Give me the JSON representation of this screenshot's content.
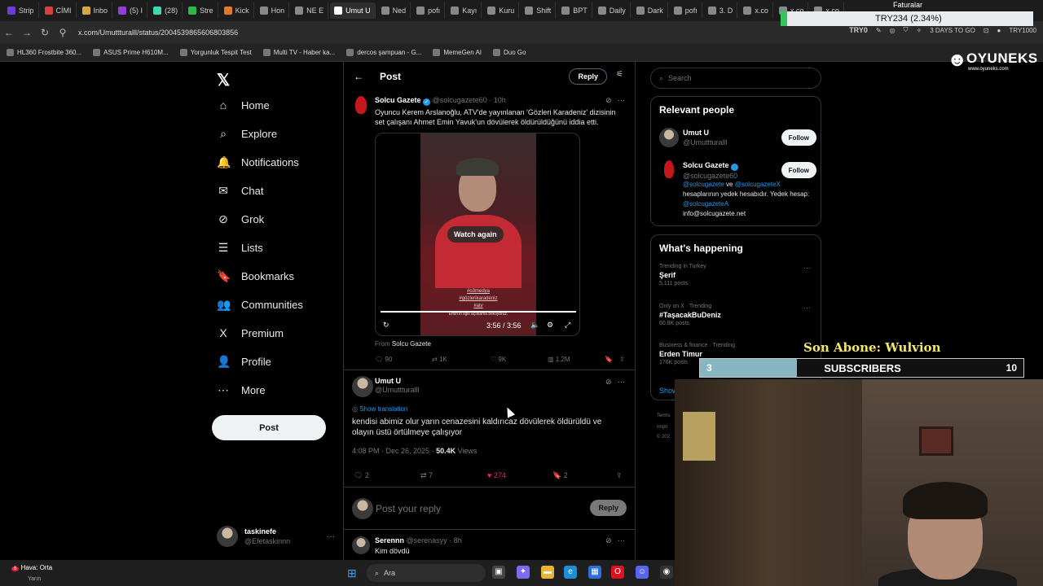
{
  "browser": {
    "tabs": [
      {
        "label": "Strip",
        "color": "#6b3fd6"
      },
      {
        "label": "CİMI",
        "color": "#d63f3f"
      },
      {
        "label": "Inbo",
        "color": "#d6a83f"
      },
      {
        "label": "(5) I",
        "color": "#8f3fd6"
      },
      {
        "label": "(28)",
        "color": "#3fd6b0"
      },
      {
        "label": "Stre",
        "color": "#2fb84a"
      },
      {
        "label": "Kick",
        "color": "#e0792b"
      },
      {
        "label": "Hon",
        "color": "#888888"
      },
      {
        "label": "NE E",
        "color": "#888888"
      },
      {
        "label": "Umut U",
        "color": "#ffffff"
      },
      {
        "label": "Ned",
        "color": "#888888"
      },
      {
        "label": "pofı",
        "color": "#888888"
      },
      {
        "label": "Kayı",
        "color": "#888888"
      },
      {
        "label": "Kuru",
        "color": "#888888"
      },
      {
        "label": "Shift",
        "color": "#888888"
      },
      {
        "label": "BPT",
        "color": "#888888"
      },
      {
        "label": "Daily",
        "color": "#888888"
      },
      {
        "label": "Dark",
        "color": "#888888"
      },
      {
        "label": "pofı",
        "color": "#888888"
      },
      {
        "label": "3. D",
        "color": "#888888"
      },
      {
        "label": "x.co",
        "color": "#888888"
      },
      {
        "label": "x.co",
        "color": "#888888"
      },
      {
        "label": "x.co",
        "color": "#888888"
      }
    ],
    "active_tab_index": 9,
    "url": "x.com/Umuttturalll/status/2004539865606803856",
    "addr_right": {
      "ext1": "TRY0",
      "days": "3 DAYS TO GO",
      "ext2": "TRY1000"
    },
    "bookmarks": [
      {
        "label": "HL360 Frostbite 360..."
      },
      {
        "label": "ASUS Prime H610M..."
      },
      {
        "label": "Yorgunluk Tespit Test"
      },
      {
        "label": "Multi TV - Haber ka..."
      },
      {
        "label": "dercos şampuan - G..."
      },
      {
        "label": "MemeGen AI"
      },
      {
        "label": "Duo Go"
      }
    ]
  },
  "nav": {
    "items": [
      {
        "label": "Home",
        "icon": "⌂"
      },
      {
        "label": "Explore",
        "icon": "⌕"
      },
      {
        "label": "Notifications",
        "icon": "🔔"
      },
      {
        "label": "Chat",
        "icon": "✉"
      },
      {
        "label": "Grok",
        "icon": "⊘"
      },
      {
        "label": "Lists",
        "icon": "☰"
      },
      {
        "label": "Bookmarks",
        "icon": "🔖"
      },
      {
        "label": "Communities",
        "icon": "👥"
      },
      {
        "label": "Premium",
        "icon": "X"
      },
      {
        "label": "Profile",
        "icon": "👤"
      },
      {
        "label": "More",
        "icon": "⋯"
      }
    ],
    "post_label": "Post",
    "account": {
      "name": "taskinefe",
      "handle": "@Efetaskinnn"
    }
  },
  "header": {
    "title": "Post",
    "reply_label": "Reply"
  },
  "quoted_post": {
    "author": "Solcu Gazete",
    "handle": "@solcugazete60",
    "time": "10h",
    "text": "Oyuncu Kerem Arslanoğlu, ATV'de yayınlanan 'Gözleri Karadeniz' dizisinin set çalışanı Ahmet Emin Yavuk'un dövülerek öldürüldüğünü iddia etti.",
    "video": {
      "watch_again": "Watch again",
      "tags": [
        "#o3medya",
        "#gözlerikaradeniz",
        "#atv"
      ],
      "caption": "Emin'in ilgili açıklama bekliyoruz.",
      "time": "3:56 / 3:56",
      "progress": 1.0
    },
    "from_prefix": "From",
    "from_source": "Solcu Gazete",
    "stats": {
      "replies": "90",
      "reposts": "1K",
      "likes": "9K",
      "views": "1.2M"
    }
  },
  "reply_post": {
    "author": "Umut U",
    "handle": "@Umuttturalll",
    "show_translation": "Show translation",
    "text": "kendisi abimiz olur yarın cenazesini kaldırıcaz dövülerek öldürüldü ve olayın üstü örtülmeye çalışıyor",
    "timestamp": "4:08 PM · Dec 26, 2025 ·",
    "views_count": "50.4K",
    "views_label": "Views",
    "stats": {
      "replies": "2",
      "reposts": "7",
      "likes": "274",
      "bookmarks": "2"
    }
  },
  "composer": {
    "placeholder": "Post your reply",
    "button": "Reply"
  },
  "next_reply": {
    "author": "Serennn",
    "handle": "@serenasyy",
    "time": "8h",
    "text": "Kim dövdü"
  },
  "sidebar": {
    "search_placeholder": "Search",
    "relevant_title": "Relevant people",
    "people": [
      {
        "name": "Umut U",
        "handle": "@Umuttturalll",
        "follow": "Follow"
      },
      {
        "name": "Solcu Gazete",
        "handle": "@solcugazete60",
        "follow": "Follow"
      }
    ],
    "bio": {
      "link1": "@solcugazete",
      "mid": " ve ",
      "link2": "@solcugazeteX",
      "text1": " hesaplarının yedek hesabıdır. Yedek hesap: ",
      "link3": "@solcugazeteA",
      "email": "info@solcugazete.net"
    },
    "happening_title": "What's happening",
    "trends": [
      {
        "context": "Trending in Turkey",
        "name": "Şerif",
        "count": "5,111 posts"
      },
      {
        "context": "Only on X · Trending",
        "name": "#TaşacakBuDeniz",
        "count": "60.8K posts"
      },
      {
        "context": "Business & finance · Trending",
        "name": "Erden Timur",
        "count": "176K posts"
      }
    ],
    "show_more": "Show",
    "footer1": "Terms",
    "footer2": "Impri",
    "footer3": "© 202"
  },
  "overlay": {
    "ticker": "TRY234 (2.34%)",
    "ticker_top": "Faturalar",
    "brand": "OYUNEKS",
    "brand_url": "www.oyuneks.com",
    "son_abone": "Son Abone: Wulvion",
    "subs_current": "3",
    "subs_label": "SUBSCRIBERS",
    "subs_goal": "10",
    "subs_fraction": 0.3
  },
  "taskbar": {
    "weather_title": "Hava: Orta",
    "weather_sub": "Yarın",
    "weather_badge": "8",
    "search_placeholder": "Ara"
  }
}
